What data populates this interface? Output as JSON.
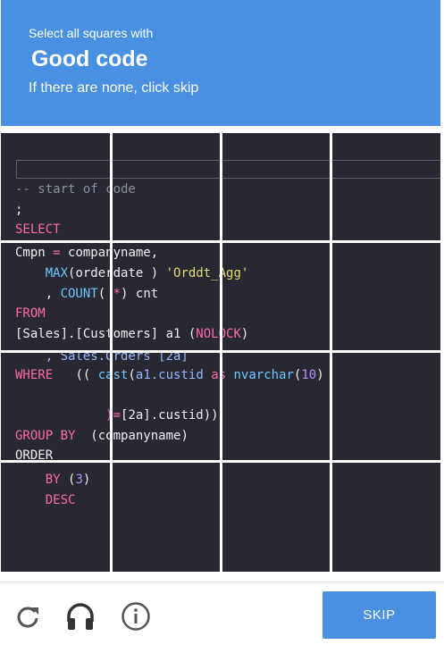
{
  "challenge": {
    "instruction": "Select all squares with",
    "keyword": "Good code",
    "subtext": "If there are none, click skip"
  },
  "code_lines": [
    "-- start of code",
    ";",
    "SELECT",
    "Cmpn = companyname,",
    "    MAX(orderdate ) 'Orddt_Agg'",
    "    , COUNT( *) cnt",
    "FROM",
    "[Sales].[Customers] a1 (NOLOCK)",
    "    , Sales.Orders [2a]",
    "WHERE   (( cast(a1.custid as nvarchar(10)",
    "            )=[2a].custid))",
    "GROUP BY  (companyname)",
    "ORDER",
    "    BY (3)",
    "    DESC"
  ],
  "footer": {
    "reload_icon": "reload-icon",
    "audio_icon": "headphones-icon",
    "info_icon": "info-icon",
    "skip_label": "SKIP"
  },
  "colors": {
    "header_bg": "#4a90e2",
    "code_bg": "#282833",
    "keyword": "#ff6aa9",
    "function": "#6ec8ff",
    "string": "#e6db74",
    "number": "#b390ff",
    "comment": "#8c8ca0"
  }
}
